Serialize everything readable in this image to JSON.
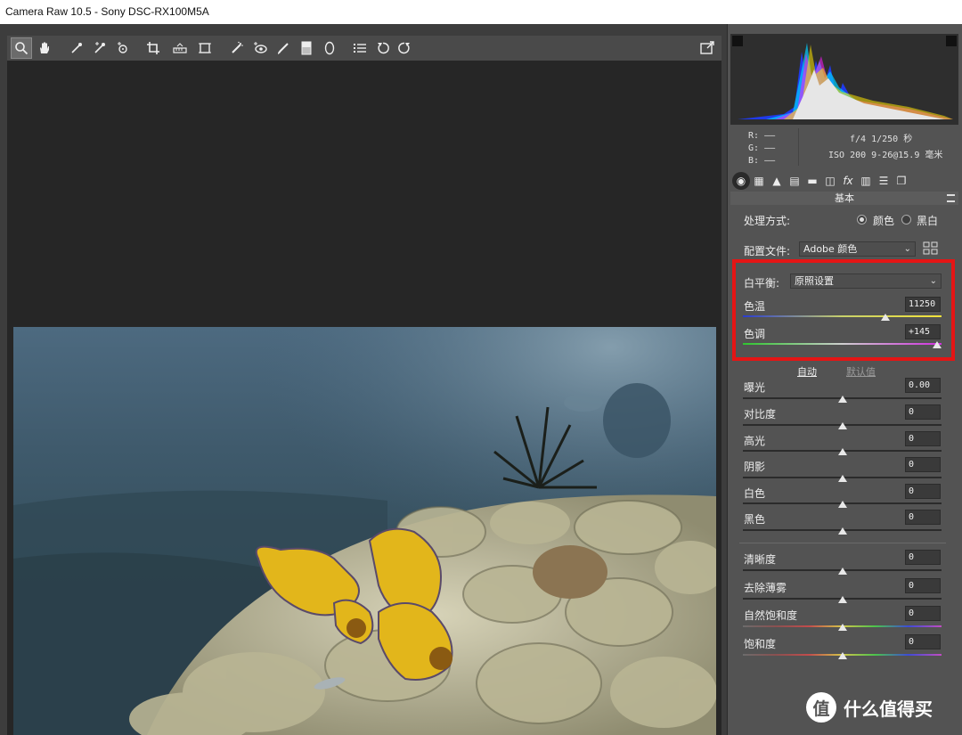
{
  "window": {
    "title": "Camera Raw 10.5 -  Sony DSC-RX100M5A"
  },
  "toolbar": {
    "tools": [
      "zoom-tool",
      "hand-tool",
      "white-balance-tool",
      "color-sampler-tool",
      "targeted-adjustment-tool",
      "crop-tool",
      "straighten-tool",
      "transform-tool",
      "spot-removal-tool",
      "red-eye-tool",
      "adjustment-brush-tool",
      "graduated-filter-tool",
      "radial-filter-tool",
      "preferences-tool",
      "rotate-ccw-tool",
      "rotate-cw-tool"
    ],
    "fullscreen": "fullscreen-toggle-icon"
  },
  "info": {
    "r_label": "R:",
    "g_label": "G:",
    "b_label": "B:",
    "r_value": "——",
    "g_value": "——",
    "b_value": "——",
    "exposure": "f/4  1/250 秒",
    "lens": "ISO 200  9-26@15.9 毫米"
  },
  "panel": {
    "section_title": "基本",
    "treatment_label": "处理方式:",
    "treatment_color": "颜色",
    "treatment_bw": "黑白",
    "profile_label": "配置文件:",
    "profile_value": "Adobe 颜色",
    "wb_label": "白平衡:",
    "wb_value": "原照设置",
    "temp_label": "色温",
    "temp_value": "11250",
    "tint_label": "色调",
    "tint_value": "+145",
    "auto_label": "自动",
    "default_label": "默认值",
    "sliders": [
      {
        "label": "曝光",
        "value": "0.00"
      },
      {
        "label": "对比度",
        "value": "0"
      },
      {
        "label": "高光",
        "value": "0"
      },
      {
        "label": "阴影",
        "value": "0"
      },
      {
        "label": "白色",
        "value": "0"
      },
      {
        "label": "黑色",
        "value": "0"
      }
    ],
    "presence": [
      {
        "label": "清晰度",
        "value": "0"
      },
      {
        "label": "去除薄雾",
        "value": "0"
      },
      {
        "label": "自然饱和度",
        "value": "0"
      },
      {
        "label": "饱和度",
        "value": "0"
      }
    ]
  },
  "watermark": {
    "glyph": "值",
    "text": "什么值得买"
  },
  "colors": {
    "highlight": "#e51515",
    "panel_bg": "#535353",
    "canvas_bg": "#262626"
  }
}
